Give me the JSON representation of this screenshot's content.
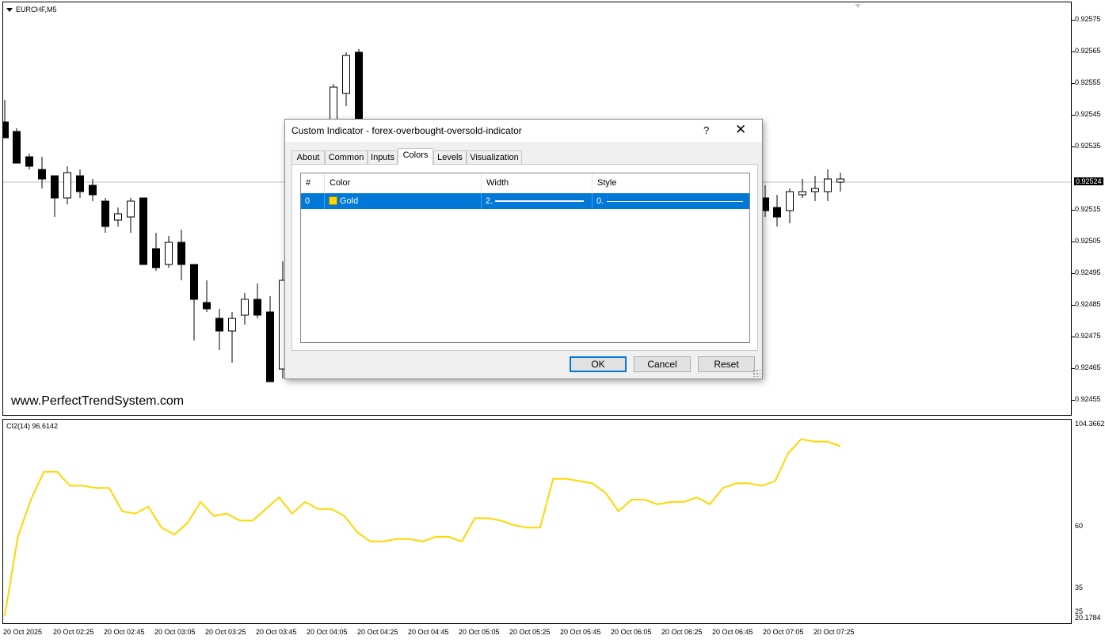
{
  "chart": {
    "symbol": "EURCHF,M5",
    "watermark": "www.PerfectTrendSystem.com",
    "current_price": "0.92524",
    "price_labels": [
      "0.92575",
      "0.92565",
      "0.92555",
      "0.92545",
      "0.92535",
      "0.92515",
      "0.92505",
      "0.92495",
      "0.92485",
      "0.92475",
      "0.92465",
      "0.92455"
    ],
    "indicator_label": "CI2(14) 96.6142",
    "indicator_axis_labels": [
      "104.3662",
      "60",
      "35",
      "25",
      "20.1784"
    ],
    "time_labels": [
      "20 Oct 2025",
      "20 Oct 02:25",
      "20 Oct 02:45",
      "20 Oct 03:05",
      "20 Oct 03:25",
      "20 Oct 03:45",
      "20 Oct 04:05",
      "20 Oct 04:25",
      "20 Oct 04:45",
      "20 Oct 05:05",
      "20 Oct 05:25",
      "20 Oct 05:45",
      "20 Oct 06:05",
      "20 Oct 06:25",
      "20 Oct 06:45",
      "20 Oct 07:05",
      "20 Oct 07:25"
    ],
    "line_color": "#FFD700",
    "candle_bull_color": "#FFFFFF",
    "candle_bear_color": "#000000"
  },
  "chart_data": {
    "type": "candlestick",
    "price_range": [
      0.9245,
      0.9258
    ],
    "candles": [
      {
        "o": 0.92543,
        "h": 0.9255,
        "l": 0.92538,
        "c": 0.92538
      },
      {
        "o": 0.9254,
        "h": 0.92541,
        "l": 0.9253,
        "c": 0.9253
      },
      {
        "o": 0.92532,
        "h": 0.92533,
        "l": 0.92528,
        "c": 0.92529
      },
      {
        "o": 0.92528,
        "h": 0.92532,
        "l": 0.92522,
        "c": 0.92525
      },
      {
        "o": 0.92526,
        "h": 0.92526,
        "l": 0.92513,
        "c": 0.92519
      },
      {
        "o": 0.92519,
        "h": 0.92529,
        "l": 0.92517,
        "c": 0.92527
      },
      {
        "o": 0.92526,
        "h": 0.92528,
        "l": 0.92519,
        "c": 0.92521
      },
      {
        "o": 0.92523,
        "h": 0.92525,
        "l": 0.92518,
        "c": 0.9252
      },
      {
        "o": 0.92518,
        "h": 0.92519,
        "l": 0.92508,
        "c": 0.9251
      },
      {
        "o": 0.92512,
        "h": 0.92516,
        "l": 0.9251,
        "c": 0.92514
      },
      {
        "o": 0.92513,
        "h": 0.92519,
        "l": 0.92508,
        "c": 0.92518
      },
      {
        "o": 0.92519,
        "h": 0.92519,
        "l": 0.92498,
        "c": 0.92498
      },
      {
        "o": 0.92503,
        "h": 0.92508,
        "l": 0.92496,
        "c": 0.92497
      },
      {
        "o": 0.92498,
        "h": 0.92507,
        "l": 0.92497,
        "c": 0.92505
      },
      {
        "o": 0.92505,
        "h": 0.92509,
        "l": 0.92493,
        "c": 0.92498
      },
      {
        "o": 0.92498,
        "h": 0.92498,
        "l": 0.92474,
        "c": 0.92487
      },
      {
        "o": 0.92486,
        "h": 0.92493,
        "l": 0.92483,
        "c": 0.92484
      },
      {
        "o": 0.92481,
        "h": 0.92484,
        "l": 0.92471,
        "c": 0.92477
      },
      {
        "o": 0.92477,
        "h": 0.92483,
        "l": 0.92467,
        "c": 0.92481
      },
      {
        "o": 0.92482,
        "h": 0.92489,
        "l": 0.92479,
        "c": 0.92487
      },
      {
        "o": 0.92487,
        "h": 0.92492,
        "l": 0.92481,
        "c": 0.92482
      },
      {
        "o": 0.92483,
        "h": 0.92488,
        "l": 0.92461,
        "c": 0.92461
      },
      {
        "o": 0.92465,
        "h": 0.92499,
        "l": 0.92462,
        "c": 0.92493
      },
      {
        "o": 0.92519,
        "h": 0.92523,
        "l": 0.92513,
        "c": 0.92515
      },
      {
        "o": 0.92516,
        "h": 0.9252,
        "l": 0.9251,
        "c": 0.92513
      },
      {
        "o": 0.92515,
        "h": 0.92522,
        "l": 0.92511,
        "c": 0.92521
      },
      {
        "o": 0.9252,
        "h": 0.92525,
        "l": 0.92519,
        "c": 0.92521
      },
      {
        "o": 0.92521,
        "h": 0.92526,
        "l": 0.92518,
        "c": 0.92522
      },
      {
        "o": 0.92521,
        "h": 0.92528,
        "l": 0.92518,
        "c": 0.92525
      },
      {
        "o": 0.92524,
        "h": 0.92527,
        "l": 0.92521,
        "c": 0.92525
      }
    ],
    "indicator": {
      "name": "CI2(14)",
      "y_range": [
        20.1784,
        104.3662
      ],
      "values": [
        22,
        56,
        72,
        84,
        84,
        78,
        78,
        77,
        77,
        67,
        66,
        69,
        60,
        57,
        62,
        71,
        65,
        66,
        63,
        63,
        68,
        73,
        66,
        71,
        68,
        68,
        65,
        58,
        54,
        54,
        55,
        55,
        54,
        56,
        56,
        54,
        64,
        64,
        63,
        61,
        60,
        60,
        81,
        81,
        80,
        79,
        75,
        67,
        72,
        72,
        70,
        71,
        71,
        73,
        70,
        77,
        79,
        79,
        78,
        80,
        92,
        98,
        97,
        97,
        95
      ]
    }
  },
  "dialog": {
    "title": "Custom Indicator - forex-overbought-oversold-indicator",
    "help_label": "?",
    "close_label": "✕",
    "tabs": [
      "About",
      "Common",
      "Inputs",
      "Colors",
      "Levels",
      "Visualization"
    ],
    "active_tab": "Colors",
    "columns": [
      "#",
      "Color",
      "Width",
      "Style"
    ],
    "rows": [
      {
        "index": "0",
        "color_name": "Gold",
        "color": "#FFD700",
        "width": "2.",
        "style": "0."
      }
    ],
    "ok_label": "OK",
    "cancel_label": "Cancel",
    "reset_label": "Reset"
  }
}
